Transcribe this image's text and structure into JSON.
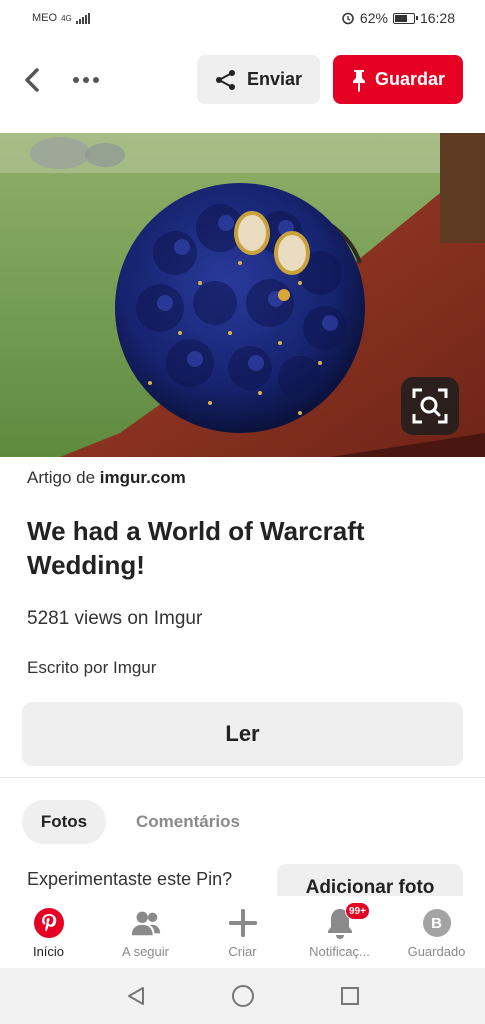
{
  "status_bar": {
    "carrier": "MEO",
    "network": "4G",
    "alarm_icon": "alarm-clock-icon",
    "battery_percent": "62%",
    "battery_level": 0.62,
    "time": "16:28"
  },
  "top_bar": {
    "back_icon": "chevron-left-icon",
    "more_icon": "more-dots-icon",
    "send_label": "Enviar",
    "send_icon": "share-icon",
    "save_label": "Guardar",
    "save_icon": "pin-icon"
  },
  "hero": {
    "lens_icon": "visual-search-icon"
  },
  "pin": {
    "source_prefix": "Artigo de",
    "source_domain": "imgur.com",
    "title": "We had a World of Warcraft Wedding!",
    "views": "5281 views on Imgur",
    "author": "Escrito por Imgur",
    "read_label": "Ler"
  },
  "tabs": {
    "photos": "Fotos",
    "comments": "Comentários"
  },
  "tried": {
    "text": "Experimentaste este Pin?",
    "add_photo_label": "Adicionar foto"
  },
  "bottom_nav": {
    "items": [
      {
        "label": "Início",
        "icon": "pinterest-logo-icon"
      },
      {
        "label": "A seguir",
        "icon": "people-icon"
      },
      {
        "label": "Criar",
        "icon": "plus-icon"
      },
      {
        "label": "Notificaç...",
        "icon": "bell-icon",
        "badge": "99+"
      },
      {
        "label": "Guardado",
        "icon": "profile-avatar-icon",
        "avatar_letter": "B"
      }
    ]
  },
  "colors": {
    "accent": "#e60023",
    "button_bg": "#efefef"
  }
}
